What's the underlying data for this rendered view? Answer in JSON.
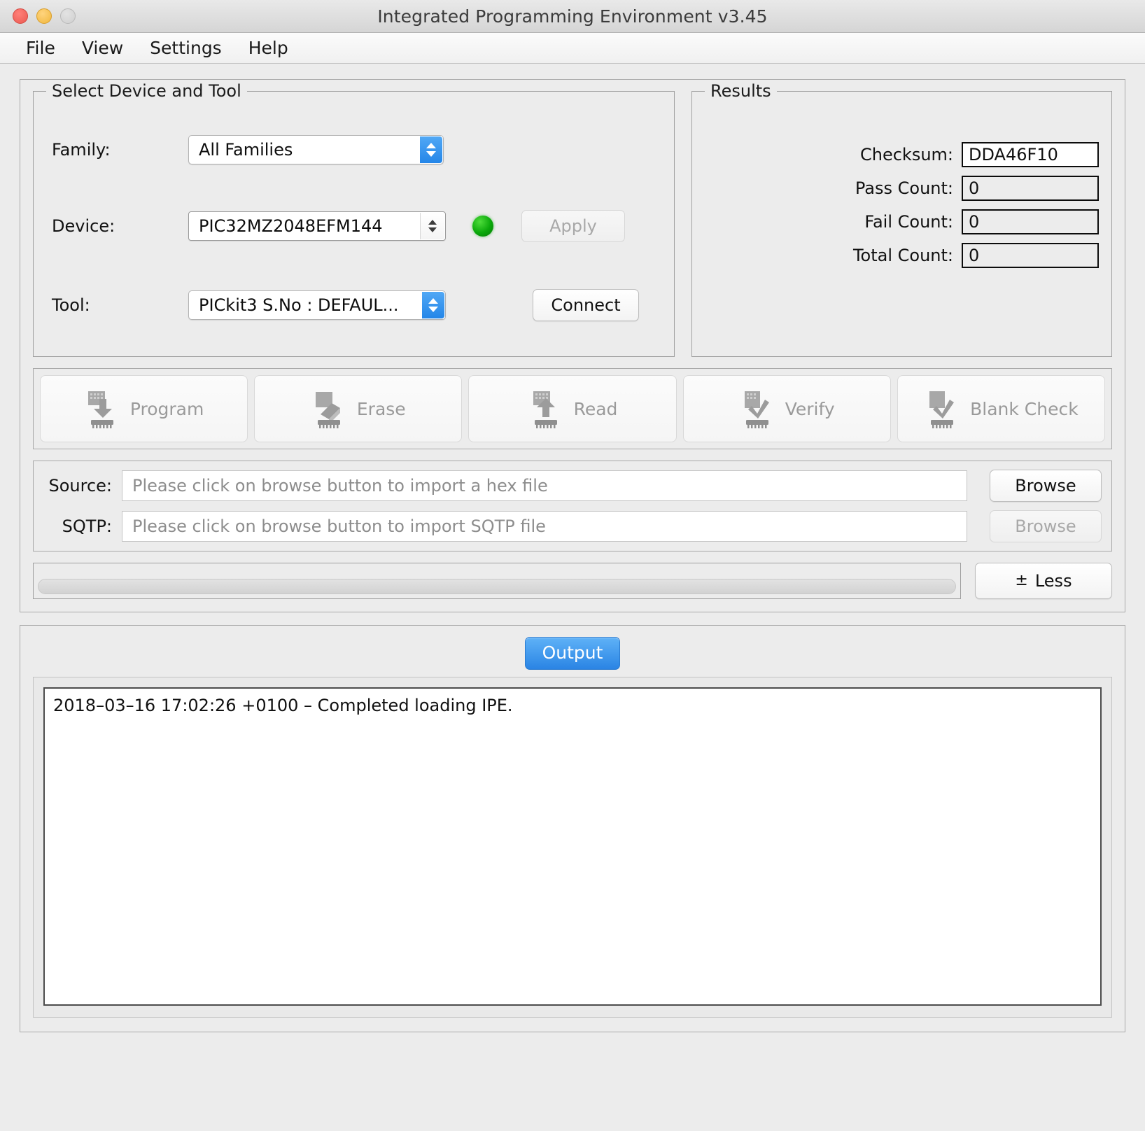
{
  "window": {
    "title": "Integrated Programming Environment v3.45",
    "controls": [
      "close",
      "minimize",
      "zoom"
    ]
  },
  "menubar": {
    "items": [
      {
        "label": "File"
      },
      {
        "label": "View"
      },
      {
        "label": "Settings"
      },
      {
        "label": "Help"
      }
    ]
  },
  "device_group": {
    "title": "Select Device and Tool",
    "family": {
      "label": "Family:",
      "value": "All Families"
    },
    "device": {
      "label": "Device:",
      "value": "PIC32MZ2048EFM144"
    },
    "tool": {
      "label": "Tool:",
      "value": "PICkit3 S.No : DEFAUL..."
    },
    "apply_button": "Apply",
    "connect_button": "Connect",
    "status_led_color": "#0aa80a"
  },
  "results_group": {
    "title": "Results",
    "rows": [
      {
        "label": "Checksum:",
        "value": "DDA46F10",
        "editable": true
      },
      {
        "label": "Pass Count:",
        "value": "0",
        "editable": false
      },
      {
        "label": "Fail Count:",
        "value": "0",
        "editable": false
      },
      {
        "label": "Total Count:",
        "value": "0",
        "editable": false
      }
    ]
  },
  "operations": [
    {
      "label": "Program",
      "icon": "chip-download-icon"
    },
    {
      "label": "Erase",
      "icon": "chip-eraser-icon"
    },
    {
      "label": "Read",
      "icon": "chip-upload-icon"
    },
    {
      "label": "Verify",
      "icon": "chip-check-icon"
    },
    {
      "label": "Blank Check",
      "icon": "chip-blank-check-icon"
    }
  ],
  "files": {
    "source": {
      "label": "Source:",
      "placeholder": "Please click on browse button to import a hex file",
      "value": "",
      "browse_label": "Browse",
      "browse_enabled": true
    },
    "sqtp": {
      "label": "SQTP:",
      "placeholder": "Please click on browse button to import SQTP file",
      "value": "",
      "browse_label": "Browse",
      "browse_enabled": false
    }
  },
  "progress": {
    "percent": 0
  },
  "less_button": {
    "glyph": "±",
    "label": "Less"
  },
  "output": {
    "tab_label": "Output",
    "accent_color": "#2a84e4",
    "log_lines": [
      "2018–03–16 17:02:26 +0100 – Completed loading IPE."
    ]
  }
}
